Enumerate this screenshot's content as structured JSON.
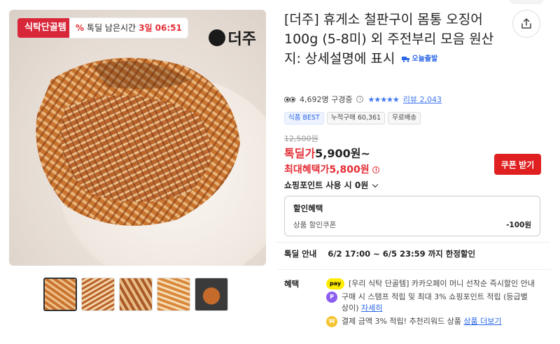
{
  "image_tags": {
    "category": "식탁단골템",
    "timer_prefix": "%",
    "timer_label": "톡딜 남은시간",
    "timer_value": "3일 06:51"
  },
  "brand": {
    "name": "더주"
  },
  "product": {
    "title": "[더주] 휴게소 철판구이 몸통 오징어 100g (5-8미) 외 주전부리 모음 원산지: 상세설명에 표시",
    "today_ship": "오늘출발"
  },
  "meta": {
    "viewers": "4,692명 구경중",
    "stars": "★★★★★",
    "reviews": "리뷰 2,043"
  },
  "badges": [
    "식품 BEST",
    "누적구매 60,361",
    "무료배송"
  ],
  "price": {
    "original": "12,500원",
    "deal_label": "톡딜가",
    "deal_value": "5,900원~",
    "max_label": "최대혜택가",
    "max_value": "5,800원",
    "coupon_button": "쿠폰 받기",
    "points": "쇼핑포인트 사용 시 0원"
  },
  "discount_box": {
    "heading": "할인혜택",
    "item_label": "상품 할인쿠폰",
    "item_value": "-100원"
  },
  "deal_info": {
    "label": "톡딜 안내",
    "value": "6/2 17:00 ~ 6/5 23:59 까지 한정할인"
  },
  "benefits": {
    "label": "혜택",
    "items": [
      {
        "icon": "pay",
        "text": "[우리 식탁 단골템] 카카오페이 머니 선착순 즉시할인 안내"
      },
      {
        "icon": "P",
        "text": "구매 시 스탬프 적립 및 최대 3% 쇼핑포인트 적립 (등급별 상이)",
        "link": "자세히"
      },
      {
        "icon": "W",
        "text": "결제 금액 3% 적립! 추천리워드 상품",
        "link": "상품 더보기"
      }
    ]
  },
  "colors": {
    "accent_red": "#e42d35",
    "accent_blue": "#2a67e8",
    "pay_yellow": "#ffeb00"
  }
}
